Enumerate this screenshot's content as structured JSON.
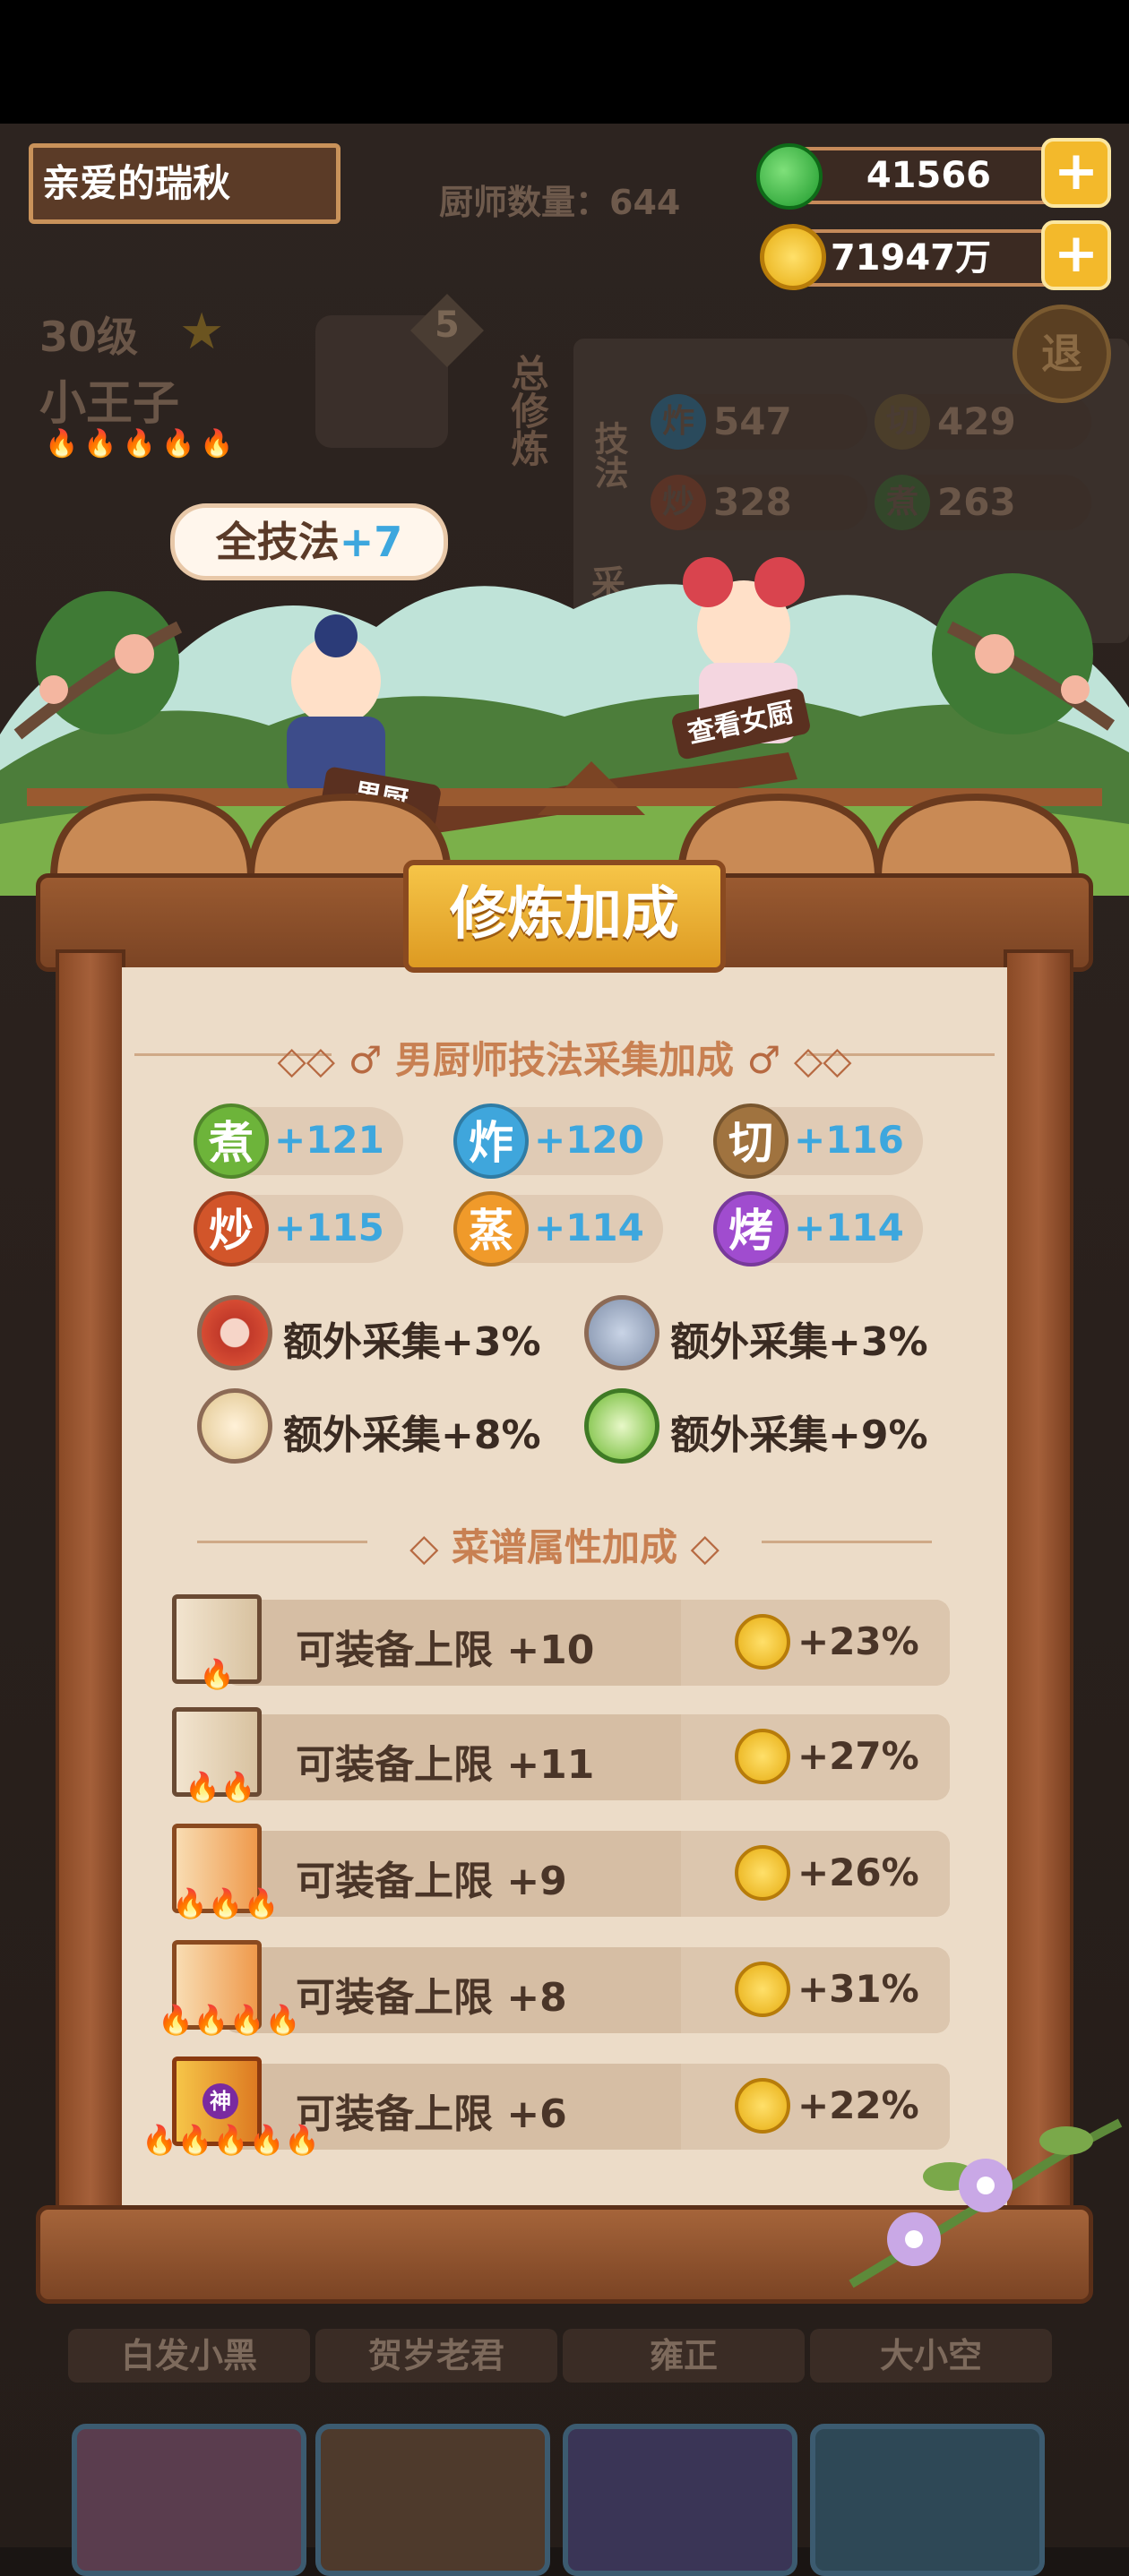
{
  "header": {
    "player_name": "亲爱的瑞秋",
    "chef_count": "厨师数量：644",
    "jade_amount": "41566",
    "coin_amount": "71947万",
    "plus": "+",
    "exit_label": "退"
  },
  "chef": {
    "level": "30级",
    "name": "小王子",
    "badge": "5",
    "train_label": "总修炼",
    "skill_label": "技法",
    "collect_label": "采",
    "stats": [
      {
        "icon": "炸",
        "value": "547"
      },
      {
        "icon": "切",
        "value": "429"
      },
      {
        "icon": "炒",
        "value": "328"
      },
      {
        "icon": "煮",
        "value": "263"
      }
    ]
  },
  "scene": {
    "all_skill_label": "全技法",
    "all_skill_value": "+7",
    "male_chef_sign": "男厨",
    "female_chef_sign": "查看女厨"
  },
  "panel": {
    "title": "修炼加成",
    "male_section_title": "男厨师技法采集加成",
    "skills": [
      {
        "icon": "煮",
        "value": "+121",
        "color": "#6db43a"
      },
      {
        "icon": "炸",
        "value": "+120",
        "color": "#3fa6dc"
      },
      {
        "icon": "切",
        "value": "+116",
        "color": "#a0733f"
      },
      {
        "icon": "炒",
        "value": "+115",
        "color": "#d2552a"
      },
      {
        "icon": "蒸",
        "value": "+114",
        "color": "#f09a2a"
      },
      {
        "icon": "烤",
        "value": "+114",
        "color": "#a04ccf"
      }
    ],
    "extras": [
      {
        "icon": "meat-icon",
        "text": "额外采集+3%"
      },
      {
        "icon": "fish-icon",
        "text": "额外采集+3%"
      },
      {
        "icon": "flour-icon",
        "text": "额外采集+8%"
      },
      {
        "icon": "vegetable-icon",
        "text": "额外采集+9%"
      }
    ],
    "recipe_section_title": "菜谱属性加成",
    "recipes": [
      {
        "label": "可装备上限 +10",
        "bonus": "+23%",
        "stars": 1
      },
      {
        "label": "可装备上限 +11",
        "bonus": "+27%",
        "stars": 2
      },
      {
        "label": "可装备上限 +9",
        "bonus": "+26%",
        "stars": 3
      },
      {
        "label": "可装备上限 +8",
        "bonus": "+31%",
        "stars": 4
      },
      {
        "label": "可装备上限 +6",
        "bonus": "+22%",
        "stars": 5,
        "divine": "神"
      }
    ]
  },
  "bottom": {
    "names": [
      "白发小黑",
      "贺岁老君",
      "雍正",
      "大小空"
    ]
  }
}
